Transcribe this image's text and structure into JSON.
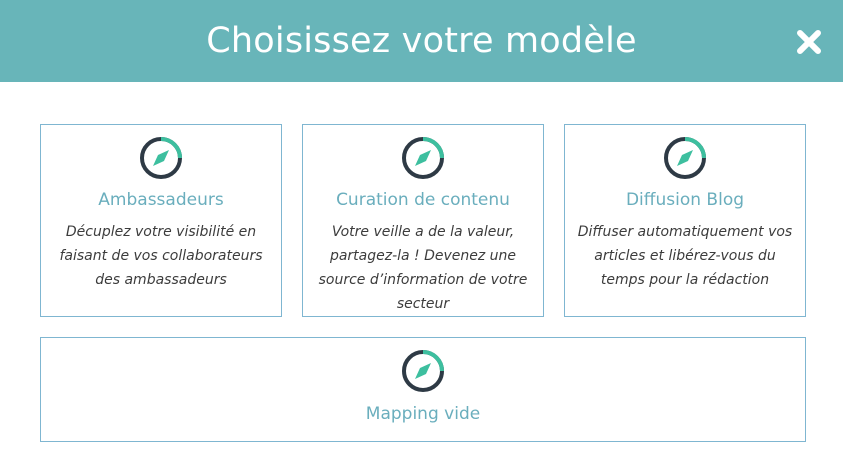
{
  "dialog": {
    "title": "Choisissez votre modèle",
    "close_icon": "close-icon",
    "header_color": "#68b5b9",
    "accent_color": "#3dbf9f"
  },
  "templates": [
    {
      "title": "Ambassadeurs",
      "description": "Décuplez votre visibilité en faisant de vos collaborateurs des ambassadeurs",
      "icon": "compass-icon"
    },
    {
      "title": "Curation de contenu",
      "description": "Votre veille a de la valeur, partagez-la ! Devenez une source d’information de votre secteur",
      "icon": "compass-icon"
    },
    {
      "title": "Diffusion Blog",
      "description": "Diffuser automatiquement vos articles et libérez-vous du temps pour la rédaction",
      "icon": "compass-icon"
    },
    {
      "title": "Mapping vide",
      "icon": "compass-icon"
    }
  ]
}
